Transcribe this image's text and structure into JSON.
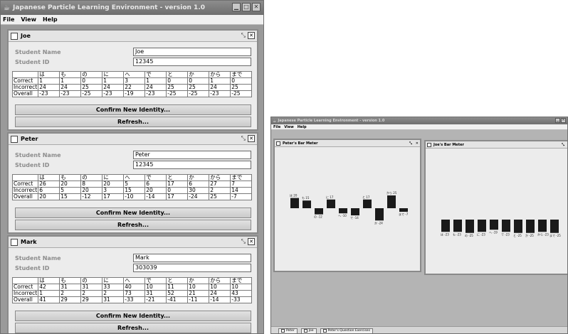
{
  "app": {
    "title": "Japanese Particle Learning Environment - version 1.0"
  },
  "menu": [
    "File",
    "View",
    "Help"
  ],
  "labels": {
    "student_name": "Student Name",
    "student_id": "Student ID",
    "confirm": "Confirm New Identity...",
    "refresh": "Refresh..."
  },
  "particles": [
    "は",
    "も",
    "の",
    "に",
    "へ",
    "で",
    "と",
    "か",
    "から",
    "まで"
  ],
  "row_labels": [
    "Correct",
    "Incorrect",
    "Overall"
  ],
  "students": [
    {
      "title": "Joe",
      "name": "Joe",
      "id": "12345",
      "correct": [
        "1",
        "1",
        "0",
        "1",
        "3",
        "1",
        "0",
        "0",
        "1",
        "0"
      ],
      "incorrect": [
        "24",
        "24",
        "25",
        "24",
        "22",
        "24",
        "25",
        "25",
        "24",
        "25"
      ],
      "overall": [
        "-23",
        "-23",
        "-25",
        "-23",
        "-19",
        "-23",
        "-25",
        "-25",
        "-23",
        "-25"
      ]
    },
    {
      "title": "Peter",
      "name": "Peter",
      "id": "12345",
      "correct": [
        "26",
        "20",
        "8",
        "20",
        "5",
        "6",
        "17",
        "6",
        "27",
        "7"
      ],
      "incorrect": [
        "6",
        "5",
        "20",
        "3",
        "15",
        "20",
        "0",
        "30",
        "2",
        "14"
      ],
      "overall": [
        "20",
        "15",
        "-12",
        "17",
        "-10",
        "-14",
        "17",
        "-24",
        "25",
        "-7"
      ]
    },
    {
      "title": "Mark",
      "name": "Mark",
      "id": "303039",
      "correct": [
        "42",
        "31",
        "31",
        "33",
        "40",
        "10",
        "11",
        "10",
        "10",
        "10"
      ],
      "incorrect": [
        "1",
        "2",
        "2",
        "2",
        "73",
        "31",
        "52",
        "21",
        "24",
        "43"
      ],
      "overall": [
        "41",
        "29",
        "29",
        "31",
        "-33",
        "-21",
        "-41",
        "-11",
        "-14",
        "-33"
      ]
    }
  ],
  "meters": [
    {
      "title": "Peter's Bar Meter",
      "labels": [
        "は 20",
        "も 15",
        "の -12",
        "に 17",
        "へ -10",
        "で -14",
        "と 17",
        "か -24",
        "から 25",
        "まで -7"
      ],
      "values": [
        20,
        15,
        -12,
        17,
        -10,
        -14,
        17,
        -24,
        25,
        -7
      ]
    },
    {
      "title": "Joe's Bar Meter",
      "labels": [
        "は -23",
        "も -23",
        "の -25",
        "に -23",
        "へ -19",
        "で -23",
        "と -25",
        "か -25",
        "から -23",
        "まで -25"
      ],
      "values": [
        -23,
        -23,
        -25,
        -23,
        -19,
        -23,
        -25,
        -25,
        -23,
        -25
      ]
    }
  ],
  "taskbar": [
    "Peter",
    "Joe",
    "Peter's Question Exercises"
  ],
  "colors": {
    "bar": "#1a1a1a",
    "desktop": "#b4b4b4",
    "titlebar": "#7a7a7a"
  }
}
